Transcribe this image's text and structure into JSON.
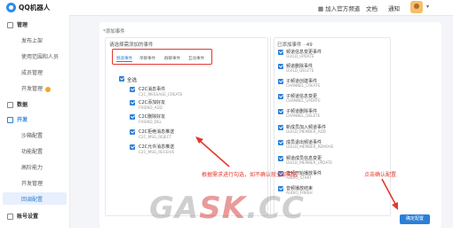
{
  "header": {
    "brand": "QQ机器人",
    "links": [
      "▦  加入官方频道",
      "文档",
      "通知"
    ]
  },
  "sidebar": {
    "items": [
      {
        "label": "管理",
        "type": "group"
      },
      {
        "label": "发布上架",
        "type": "item"
      },
      {
        "label": "使用范围和人员",
        "type": "item"
      },
      {
        "label": "成员管理",
        "type": "item"
      },
      {
        "label": "开发管理",
        "type": "item",
        "dot": true
      },
      {
        "label": "数据",
        "type": "group"
      },
      {
        "label": "开发",
        "type": "group-open"
      },
      {
        "label": "沙箱配置",
        "type": "item"
      },
      {
        "label": "功能配置",
        "type": "item"
      },
      {
        "label": "高阶能力",
        "type": "item"
      },
      {
        "label": "开发管理",
        "type": "item"
      },
      {
        "label": "回调配置",
        "type": "item-active"
      },
      {
        "label": "账号设置",
        "type": "group"
      }
    ]
  },
  "breadcrumb": "*添加事件",
  "left_panel": {
    "title": "请选择需添加的事件",
    "tabs": [
      "频道事件",
      "单聊事件",
      "群聊事件",
      "互动事件"
    ],
    "select_all": "全选",
    "events": [
      {
        "title": "C2C消息事件",
        "code": "C2C_MESSAGE_CREATE"
      },
      {
        "title": "C2C添加好友",
        "code": "FRIEND_ADD"
      },
      {
        "title": "C2C删除好友",
        "code": "FRIEND_DEL"
      },
      {
        "title": "C2C拒绝消息推送",
        "code": "C2C_MSG_REJECT"
      },
      {
        "title": "C2C允许消息推送",
        "code": "C2C_MSG_RECEIVE"
      }
    ]
  },
  "right_panel": {
    "title": "已添加事件 · 49",
    "events": [
      {
        "title": "频道信息变更事件",
        "code": "GUILD_UPDATE"
      },
      {
        "title": "频道删除事件",
        "code": "GUILD_DELETE"
      },
      {
        "title": "子频道创建事件",
        "code": "CHANNEL_CREATE"
      },
      {
        "title": "子频道信息变更",
        "code": "CHANNEL_UPDATE"
      },
      {
        "title": "子频道删除事件",
        "code": "CHANNEL_DELETE"
      },
      {
        "title": "新成员加入频道事件",
        "code": "GUILD_MEMBER_ADD"
      },
      {
        "title": "成员退出频道事件",
        "code": "GUILD_MEMBER_REMOVE"
      },
      {
        "title": "频道成员信息变更",
        "code": "GUILD_MEMBER_UPDATE"
      },
      {
        "title": "音频开始播放事件",
        "code": "AUDIO_START"
      },
      {
        "title": "音频播放结束",
        "code": "AUDIO_FINISH"
      }
    ]
  },
  "annotations": {
    "left_note": "根据需求进行勾选，如不确认就全部勾选",
    "right_note": "点击确认配置"
  },
  "save_button": "确定配置",
  "watermark": {
    "part1": "GA",
    "part2": "SK",
    "part3": ".CC"
  },
  "colors": {
    "accent": "#2b7fd8",
    "annotation": "#e0392e"
  }
}
